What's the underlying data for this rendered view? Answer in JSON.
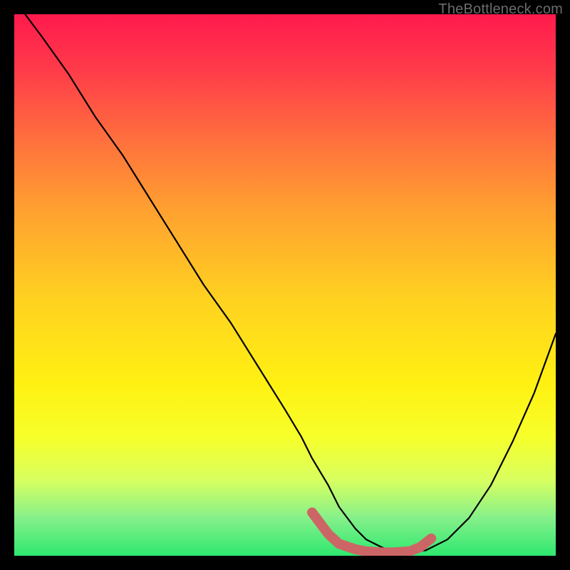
{
  "watermark": "TheBottleneck.com",
  "chart_data": {
    "type": "line",
    "title": "",
    "xlabel": "",
    "ylabel": "",
    "xlim": [
      0,
      100
    ],
    "ylim": [
      0,
      100
    ],
    "series": [
      {
        "name": "bottleneck-curve",
        "x": [
          2,
          5,
          10,
          15,
          20,
          25,
          30,
          35,
          40,
          45,
          50,
          53,
          55,
          58,
          60,
          63,
          65,
          68,
          70,
          73,
          76,
          80,
          84,
          88,
          92,
          96,
          100
        ],
        "y": [
          100,
          96,
          89,
          81,
          74,
          66,
          58,
          50,
          43,
          35,
          27,
          22,
          18,
          13,
          9,
          5,
          3,
          1.5,
          0.8,
          0.6,
          1,
          3,
          7,
          13,
          21,
          30,
          41
        ]
      }
    ],
    "highlight": {
      "name": "optimal-range",
      "color": "#cc6666",
      "x": [
        55,
        58,
        60,
        63,
        65,
        68,
        70,
        73,
        75,
        77
      ],
      "y": [
        8,
        4,
        2.2,
        1.2,
        0.8,
        0.6,
        0.6,
        0.8,
        1.6,
        3.2
      ]
    }
  }
}
